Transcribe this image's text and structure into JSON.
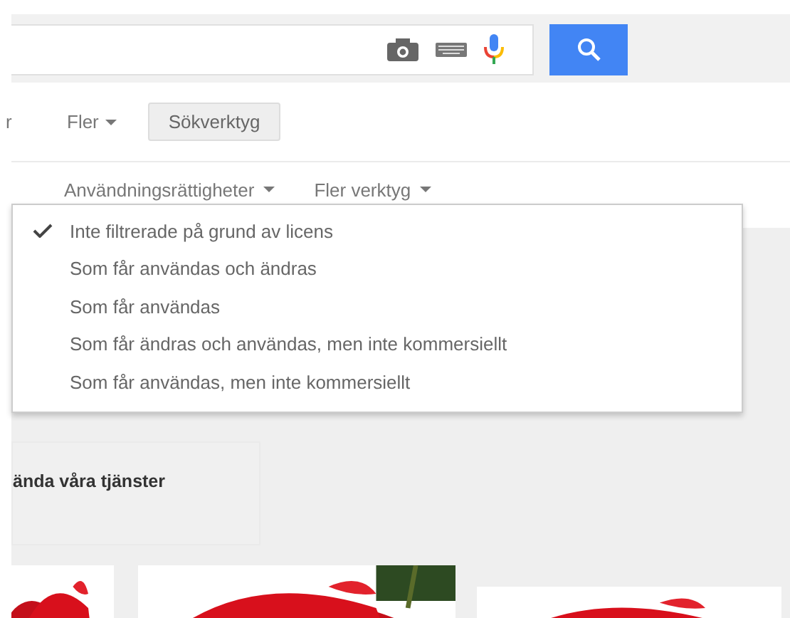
{
  "nav": {
    "cut_item": "r",
    "more": "Fler",
    "tools_button": "Sökverktyg"
  },
  "tools_row": [
    {
      "label": "Användningsrättigheter"
    },
    {
      "label": "Fler verktyg"
    }
  ],
  "usage_rights_menu": [
    {
      "label": "Inte filtrerade på grund av licens",
      "selected": true
    },
    {
      "label": "Som får användas och ändras",
      "selected": false
    },
    {
      "label": "Som får användas",
      "selected": false
    },
    {
      "label": "Som får ändras och användas, men inte kommersiellt",
      "selected": false
    },
    {
      "label": "Som får användas, men inte kommersiellt",
      "selected": false
    }
  ],
  "notice_card": {
    "text": "ända våra tjänster"
  }
}
